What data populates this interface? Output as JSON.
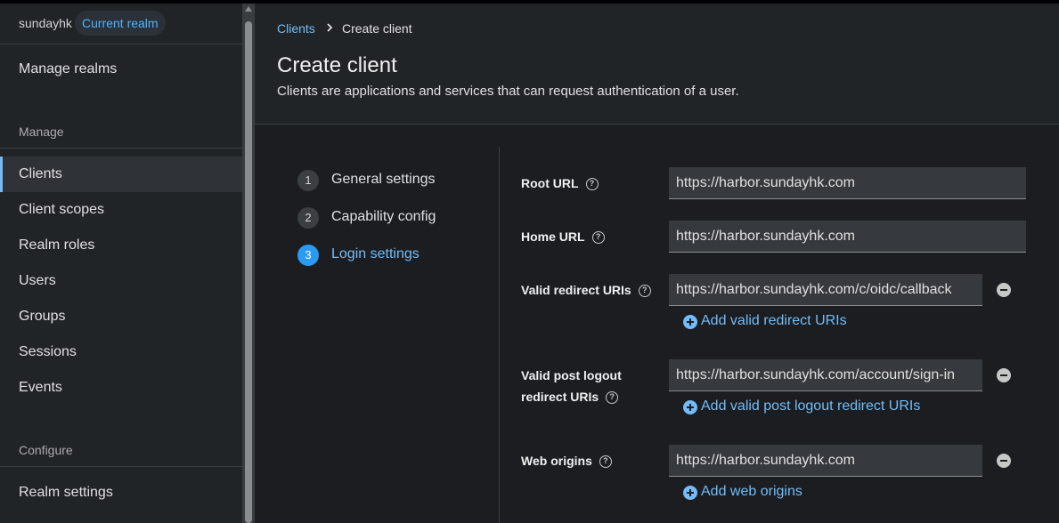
{
  "sidebar": {
    "realm_name": "sundayhk",
    "realm_badge": "Current realm",
    "manage_realms": "Manage realms",
    "manage_label": "Manage",
    "items": [
      {
        "label": "Clients"
      },
      {
        "label": "Client scopes"
      },
      {
        "label": "Realm roles"
      },
      {
        "label": "Users"
      },
      {
        "label": "Groups"
      },
      {
        "label": "Sessions"
      },
      {
        "label": "Events"
      }
    ],
    "configure_label": "Configure",
    "realm_settings": "Realm settings"
  },
  "breadcrumb": {
    "parent": "Clients",
    "current": "Create client"
  },
  "header": {
    "title": "Create client",
    "description": "Clients are applications and services that can request authentication of a user."
  },
  "steps": [
    {
      "number": "1",
      "label": "General settings"
    },
    {
      "number": "2",
      "label": "Capability config"
    },
    {
      "number": "3",
      "label": "Login settings"
    }
  ],
  "form": {
    "root_url": {
      "label": "Root URL",
      "value": "https://harbor.sundayhk.com"
    },
    "home_url": {
      "label": "Home URL",
      "value": "https://harbor.sundayhk.com"
    },
    "redirect_uris": {
      "label": "Valid redirect URIs",
      "value": "https://harbor.sundayhk.com/c/oidc/callback",
      "add_label": "Add valid redirect URIs"
    },
    "post_logout": {
      "label_line1": "Valid post logout",
      "label_line2": "redirect URIs",
      "value": "https://harbor.sundayhk.com/account/sign-in",
      "add_label": "Add valid post logout redirect URIs"
    },
    "web_origins": {
      "label": "Web origins",
      "value": "https://harbor.sundayhk.com",
      "add_label": "Add web origins"
    }
  },
  "colors": {
    "accent": "#73bcf7",
    "step_active": "#2b9af3"
  }
}
